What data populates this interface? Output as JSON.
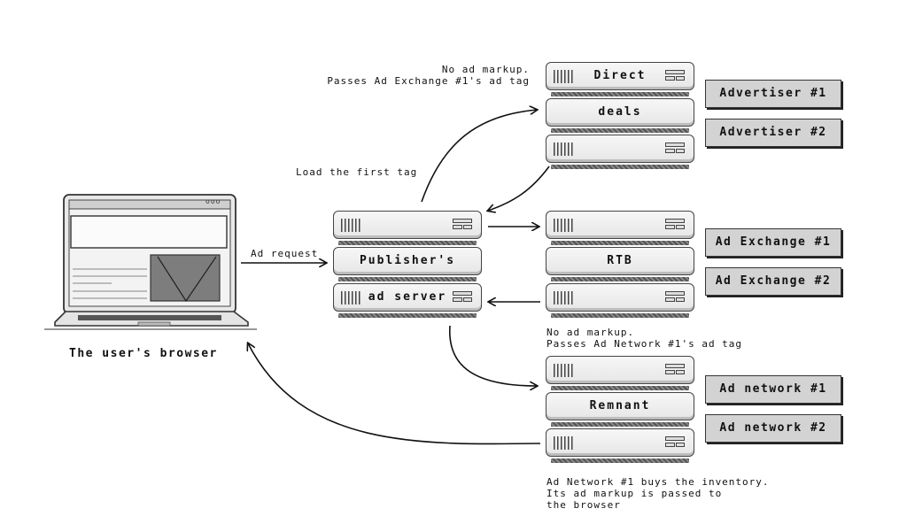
{
  "diagram": {
    "browser": {
      "label": "The user's browser",
      "window_controls": "ooo"
    },
    "ad_request_label": "Ad request",
    "load_first_tag_label": "Load the first tag",
    "publisher_server": {
      "line1": "Publisher's",
      "line2": "ad server"
    },
    "direct": {
      "line1": "Direct",
      "line2": "deals",
      "note": "No ad markup.\nPasses Ad Exchange #1's ad tag",
      "entities": [
        "Advertiser #1",
        "Advertiser #2"
      ]
    },
    "rtb": {
      "label": "RTB",
      "note": "No ad markup.\nPasses Ad Network #1's ad tag",
      "entities": [
        "Ad Exchange #1",
        "Ad Exchange #2"
      ]
    },
    "remnant": {
      "label": "Remnant",
      "note": "Ad Network #1 buys the inventory.\nIts ad markup is passed to\nthe browser",
      "entities": [
        "Ad network #1",
        "Ad network #2"
      ]
    }
  }
}
